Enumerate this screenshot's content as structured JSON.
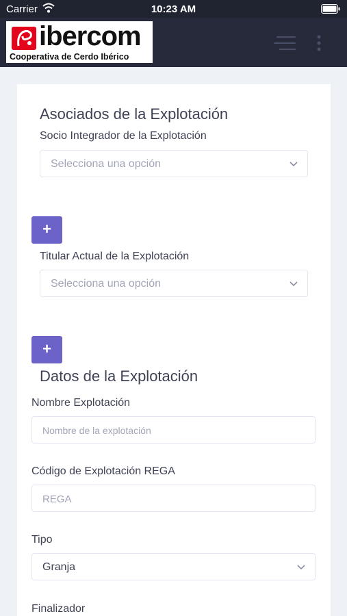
{
  "status_bar": {
    "carrier": "Carrier",
    "time": "10:23 AM"
  },
  "header": {
    "logo_wordmark": "ibercom",
    "logo_tagline": "Cooperativa de Cerdo Ibérico",
    "brand_color": "#e3051b",
    "menu_icon": "hamburger-menu-icon",
    "more_icon": "vertical-dots-icon"
  },
  "associates": {
    "title": "Asociados de la Explotación",
    "integrator_label": "Socio Integrador de la Explotación",
    "integrator_placeholder": "Selecciona una opción",
    "add_label": "+",
    "owner_label": "Titular Actual de la Explotación",
    "owner_placeholder": "Selecciona una opción"
  },
  "farm": {
    "title": "Datos de la Explotación",
    "name_label": "Nombre Explotación",
    "name_placeholder": "Nombre de la explotación",
    "rega_label": "Código de Explotación REGA",
    "rega_placeholder": "REGA",
    "type_label": "Tipo",
    "type_value": "Granja",
    "finisher_label": "Finalizador"
  },
  "colors": {
    "accent_button": "#6c63c8",
    "topbar": "#262a3b"
  }
}
